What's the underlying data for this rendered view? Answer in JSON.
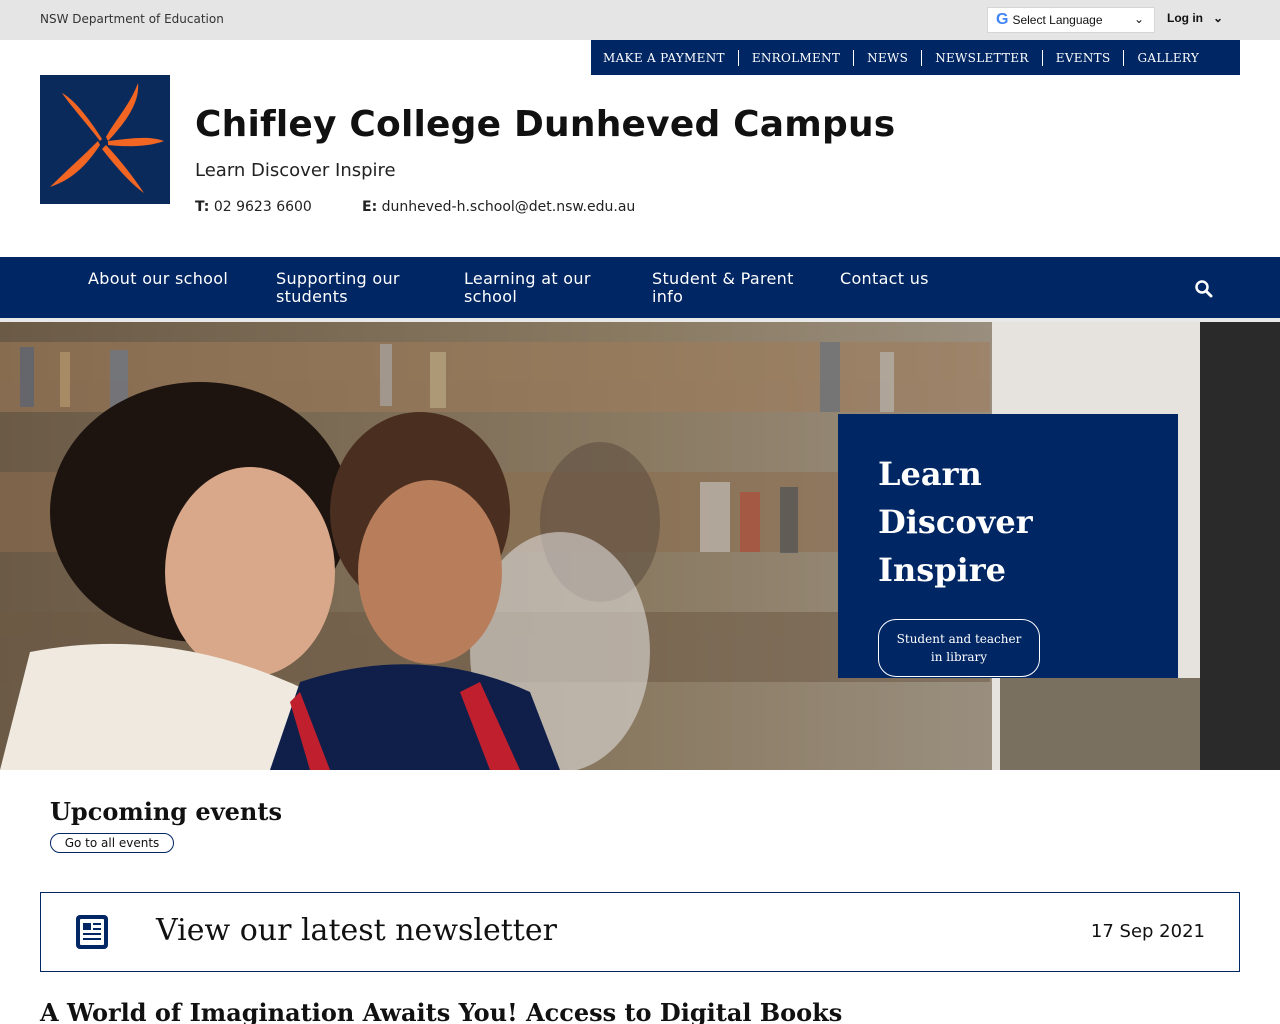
{
  "topbar": {
    "department": "NSW Department of Education",
    "language_label": "Select Language",
    "login_label": "Log in"
  },
  "quick_links": [
    "MAKE A PAYMENT",
    "ENROLMENT",
    "NEWS",
    "NEWSLETTER",
    "EVENTS",
    "GALLERY"
  ],
  "header": {
    "title": "Chifley College Dunheved Campus",
    "motto": "Learn Discover Inspire",
    "phone_label": "T:",
    "phone": "02 9623 6600",
    "email_label": "E:",
    "email": "dunheved-h.school@det.nsw.edu.au"
  },
  "main_nav": {
    "items": [
      {
        "label": "About our school"
      },
      {
        "label": "Supporting our students"
      },
      {
        "label": "Learning at our school"
      },
      {
        "label": "Student & Parent info"
      },
      {
        "label": "Contact us"
      }
    ]
  },
  "hero": {
    "heading": "Learn Discover Inspire",
    "button_label": "Student and teacher in library"
  },
  "events": {
    "heading": "Upcoming events",
    "button_label": "Go to all events"
  },
  "newsletter": {
    "label": "View our latest newsletter",
    "date": "17 Sep 2021"
  },
  "article": {
    "heading": "A World of Imagination Awaits You! Access to Digital Books"
  },
  "colors": {
    "brand_navy": "#002664",
    "logo_orange": "#f26522"
  }
}
